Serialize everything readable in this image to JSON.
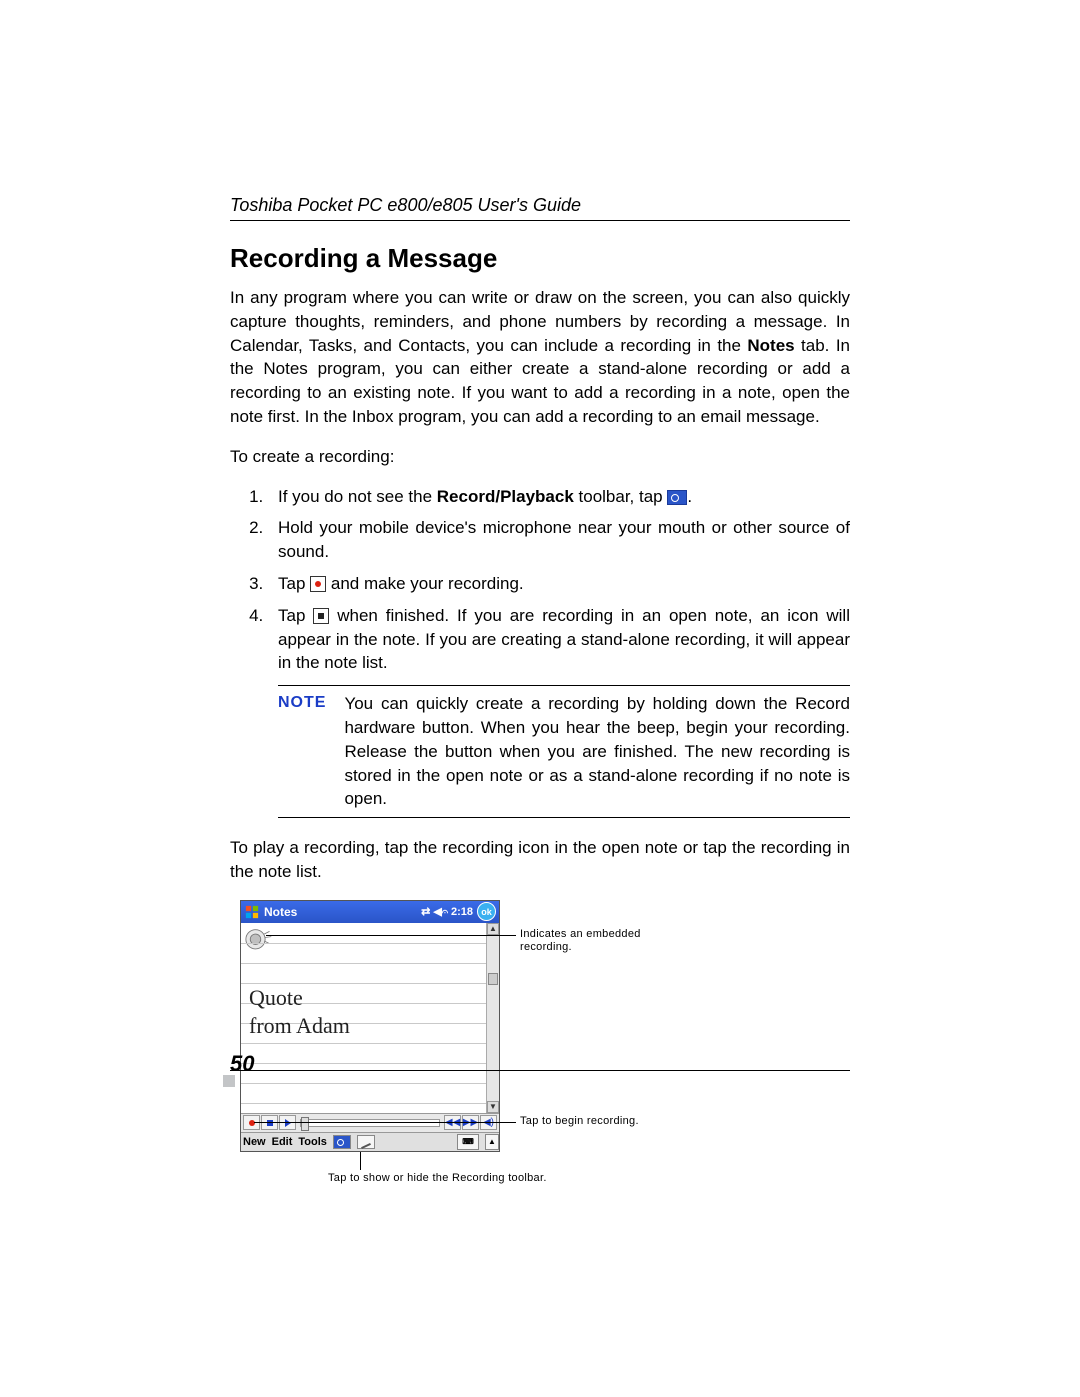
{
  "header": {
    "guide_title": "Toshiba Pocket PC  e800/e805 User's Guide"
  },
  "section": {
    "title": "Recording a Message",
    "intro_part1": "In any program where you can write or draw on the screen, you can also quickly capture thoughts, reminders, and phone numbers by recording a message. In Calendar, Tasks, and Contacts, you can include a recording in the ",
    "intro_bold": "Notes",
    "intro_part2": " tab. In the Notes program, you can either create a stand-alone recording or add a recording to an existing note. If you want to add a recording in a note, open the note first. In the Inbox program, you can add a recording to an email message.",
    "to_create": "To create a recording:",
    "step1_a": "If you do not see the ",
    "step1_bold": "Record/Playback",
    "step1_b": " toolbar, tap ",
    "step1_c": ".",
    "step2": "Hold your mobile device's microphone near your mouth or other source of sound.",
    "step3_a": "Tap ",
    "step3_b": " and make your recording.",
    "step4_a": "Tap ",
    "step4_b": " when finished. If you are recording in an open note, an icon will appear in the note. If you are creating a stand-alone recording, it will appear in the note list.",
    "note_label": "NOTE",
    "note_text": "You can quickly create a recording by holding down the Record hardware button. When you hear the beep, begin your recording. Release the button when you are finished. The new recording is stored in the open note or as a stand-alone recording if no note is open.",
    "play_text": "To play a recording, tap the recording icon in the open note or tap the recording in the note list."
  },
  "pda": {
    "app_title": "Notes",
    "time": "2:18",
    "ok": "ok",
    "hand_line1": "Quote",
    "hand_line2": "from Adam",
    "menu_new": "New",
    "menu_edit": "Edit",
    "menu_tools": "Tools"
  },
  "callouts": {
    "c1": "Indicates an embedded recording.",
    "c2": "Tap to begin recording.",
    "c3": "Tap to show or hide the Recording toolbar."
  },
  "page_number": "50"
}
